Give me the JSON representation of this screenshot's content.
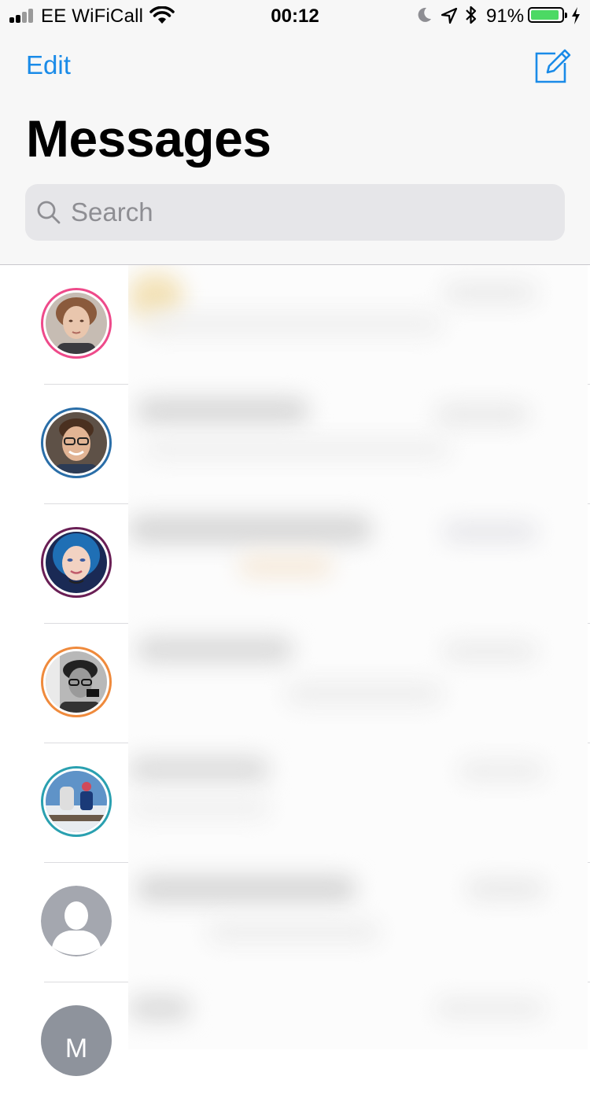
{
  "status_bar": {
    "carrier": "EE WiFiCall",
    "time": "00:12",
    "battery_percent": "91%",
    "battery_level": 0.91,
    "icons": [
      "signal-icon",
      "wifi-icon",
      "moon-icon",
      "location-icon",
      "bluetooth-icon",
      "battery-icon",
      "charging-icon"
    ]
  },
  "nav": {
    "edit_label": "Edit",
    "compose_icon": "compose-icon"
  },
  "title": "Messages",
  "search": {
    "placeholder": "Search",
    "value": ""
  },
  "colors": {
    "accent": "#1a8be8",
    "header_bg": "#f7f7f7",
    "search_bg": "#e6e6e9",
    "battery_fill": "#4cd964"
  },
  "conversations": [
    {
      "avatar": "photo",
      "ring_color": "#ee4a8a"
    },
    {
      "avatar": "photo",
      "ring_color": "#2a6ea8"
    },
    {
      "avatar": "photo",
      "ring_color": "#6a1f55"
    },
    {
      "avatar": "photo",
      "ring_color": "#ef8a3c"
    },
    {
      "avatar": "photo",
      "ring_color": "#2aa0b0"
    },
    {
      "avatar": "placeholder-person-icon",
      "ring_color": "#a4a7af"
    },
    {
      "avatar": "initial",
      "initial": "M",
      "ring_color": "#8e939c"
    }
  ]
}
